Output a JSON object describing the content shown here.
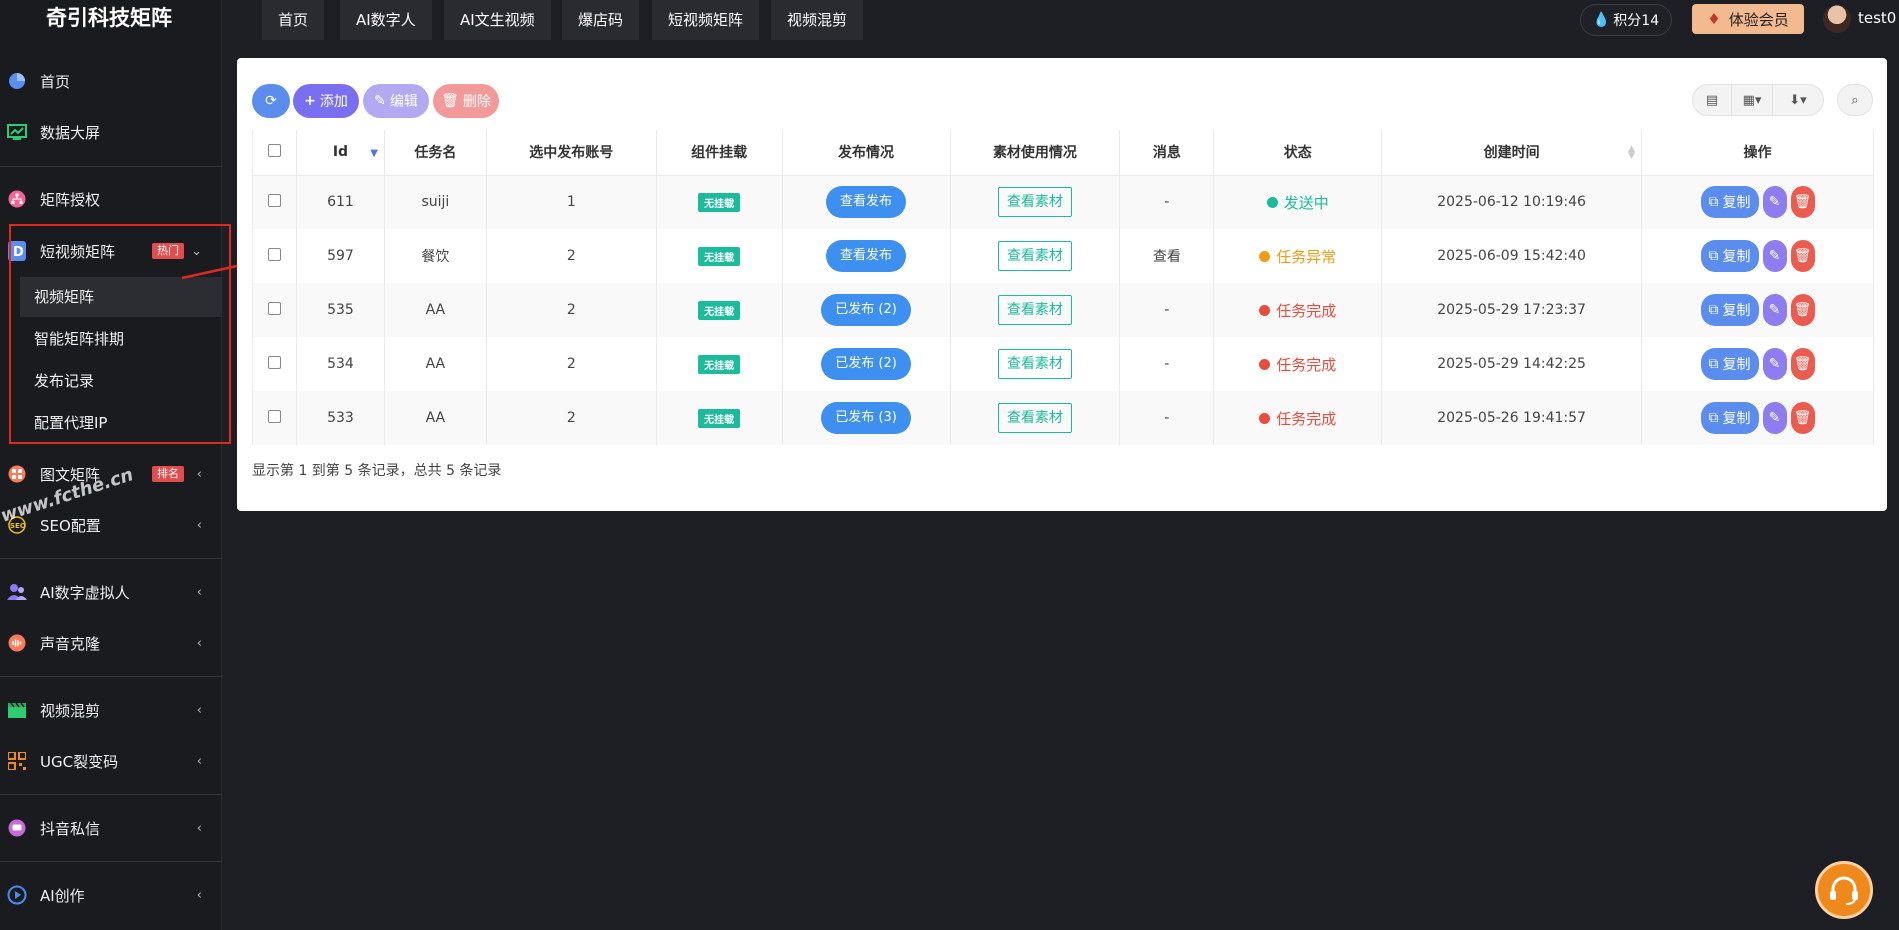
{
  "brand": "奇引科技矩阵",
  "top_tabs": [
    "首页",
    "AI数字人",
    "AI文生视频",
    "爆店码",
    "短视频矩阵",
    "视频混剪"
  ],
  "points": "积分14",
  "vip": "体验会员",
  "username": "test0",
  "sidebar": {
    "home": "首页",
    "dashboard": "数据大屏",
    "auth": "矩阵授权",
    "short_video": "短视频矩阵",
    "hot_badge": "热门",
    "sub": [
      "视频矩阵",
      "智能矩阵排期",
      "发布记录",
      "配置代理IP"
    ],
    "image_text": "图文矩阵",
    "image_badge": "排名",
    "seo": "SEO配置",
    "ai_avatar": "AI数字虚拟人",
    "voice": "声音克隆",
    "mix": "视频混剪",
    "ugc": "UGC裂变码",
    "dm": "抖音私信",
    "ai_create": "AI创作"
  },
  "watermark": "www.fcthe.cn",
  "toolbar": {
    "add": "添加",
    "edit": "编辑",
    "delete": "删除"
  },
  "table": {
    "headers": [
      "Id",
      "任务名",
      "选中发布账号",
      "组件挂载",
      "发布情况",
      "素材使用情况",
      "消息",
      "状态",
      "创建时间",
      "操作"
    ],
    "rows": [
      {
        "id": "611",
        "name": "suiji",
        "accounts": "1",
        "mount": "无挂载",
        "publish": "查看发布",
        "material": "查看素材",
        "msg": "-",
        "status": "发送中",
        "status_color": "#1abc9c",
        "created": "2025-06-12 10:19:46"
      },
      {
        "id": "597",
        "name": "餐饮",
        "accounts": "2",
        "mount": "无挂载",
        "publish": "查看发布",
        "material": "查看素材",
        "msg": "查看",
        "status": "任务异常",
        "status_color": "#f39c12",
        "created": "2025-06-09 15:42:40"
      },
      {
        "id": "535",
        "name": "AA",
        "accounts": "2",
        "mount": "无挂载",
        "publish": "已发布 (2)",
        "material": "查看素材",
        "msg": "-",
        "status": "任务完成",
        "status_color": "#e74c3c",
        "created": "2025-05-29 17:23:37"
      },
      {
        "id": "534",
        "name": "AA",
        "accounts": "2",
        "mount": "无挂载",
        "publish": "已发布 (2)",
        "material": "查看素材",
        "msg": "-",
        "status": "任务完成",
        "status_color": "#e74c3c",
        "created": "2025-05-29 14:42:25"
      },
      {
        "id": "533",
        "name": "AA",
        "accounts": "2",
        "mount": "无挂载",
        "publish": "已发布 (3)",
        "material": "查看素材",
        "msg": "-",
        "status": "任务完成",
        "status_color": "#e74c3c",
        "created": "2025-05-26 19:41:57"
      }
    ],
    "copy_label": "复制"
  },
  "pagination_text": "显示第 1 到第 5 条记录，总共 5 条记录"
}
